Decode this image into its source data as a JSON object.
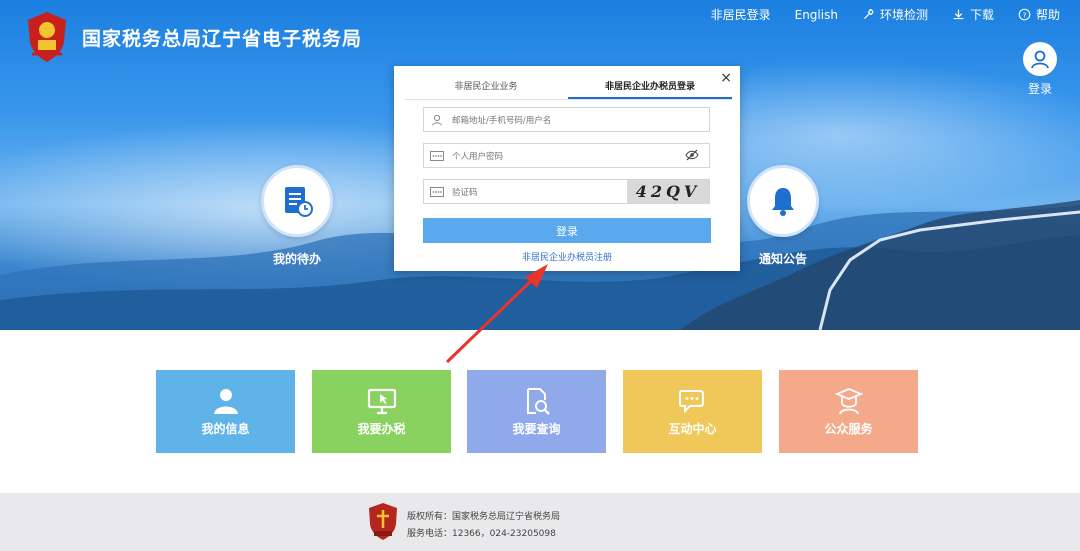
{
  "header": {
    "site_title": "国家税务总局辽宁省电子税务局",
    "nav": [
      {
        "label": "非居民登录",
        "icon": ""
      },
      {
        "label": "English",
        "icon": ""
      },
      {
        "label": "环境检测",
        "icon": "wrench-icon"
      },
      {
        "label": "下载",
        "icon": "download-icon"
      },
      {
        "label": "帮助",
        "icon": "help-icon"
      }
    ],
    "login_label": "登录"
  },
  "banner": {
    "left_circle_label": "我的待办",
    "right_circle_label": "通知公告"
  },
  "modal": {
    "close_label": "×",
    "tabs": [
      {
        "label": "非居民企业业务",
        "active": false
      },
      {
        "label": "非居民企业办税员登录",
        "active": true
      }
    ],
    "account_placeholder": "邮箱地址/手机号码/用户名",
    "password_placeholder": "个人用户密码",
    "captcha_placeholder": "验证码",
    "captcha_text": "42QV",
    "login_button": "登录",
    "register_link": "非居民企业办税员注册"
  },
  "tiles": [
    {
      "label": "我的信息",
      "color": "#5fb3e8",
      "icon": "user-icon"
    },
    {
      "label": "我要办税",
      "color": "#8ad25f",
      "icon": "monitor-icon"
    },
    {
      "label": "我要查询",
      "color": "#8fa9ea",
      "icon": "search-doc-icon"
    },
    {
      "label": "互动中心",
      "color": "#f0c85a",
      "icon": "chat-icon"
    },
    {
      "label": "公众服务",
      "color": "#f4a98a",
      "icon": "graduate-icon"
    }
  ],
  "footer": {
    "copyright": "版权所有：国家税务总局辽宁省税务局",
    "phone": "服务电话：12366，024-23205098"
  },
  "colors": {
    "banner_top": "#1b7fe0",
    "login_button": "#5aa9ef",
    "link": "#3470c8",
    "arrow": "#e8352a"
  }
}
